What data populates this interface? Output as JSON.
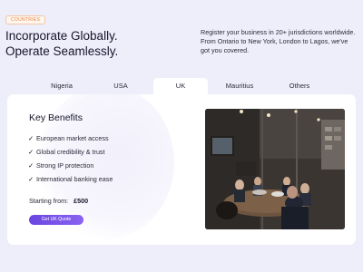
{
  "badge": "COUNTRIES",
  "headline": {
    "line1": "Incorporate Globally.",
    "line2": "Operate Seamlessly."
  },
  "intro": "Register your business in 20+ jurisdictions worldwide. From Ontario to New York, London to Lagos, we've got you covered.",
  "tabs": [
    "Nigeria",
    "USA",
    "UK",
    "Mauritius",
    "Others"
  ],
  "active_tab": "UK",
  "card": {
    "title": "Key Benefits",
    "check_glyph": "✓",
    "benefits": [
      "European market access",
      "Global credibility & trust",
      "Strong IP protection",
      "International banking ease"
    ],
    "price_label": "Starting from:",
    "price_value": "£500",
    "cta_label": "Get UK Quote"
  },
  "colors": {
    "background": "#eeeefb",
    "accent": "#7a53ea",
    "badge": "#e8823b"
  }
}
